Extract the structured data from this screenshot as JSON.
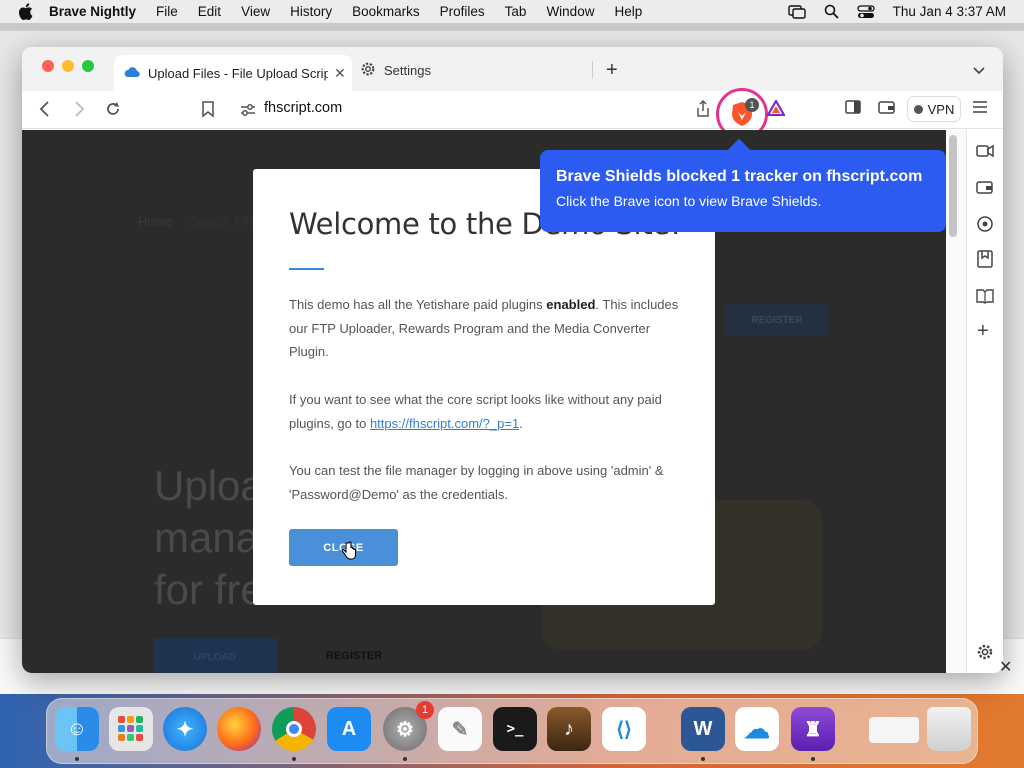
{
  "menubar": {
    "app_name": "Brave Nightly",
    "items": [
      "File",
      "Edit",
      "View",
      "History",
      "Bookmarks",
      "Profiles",
      "Tab",
      "Window",
      "Help"
    ],
    "clock": "Thu Jan 4  3:37 AM"
  },
  "browser": {
    "tabs": [
      {
        "title": "Upload Files - File Upload Script",
        "icon": "cloud-icon"
      },
      {
        "title": "Settings",
        "icon": "gear-icon"
      }
    ],
    "url": "fhscript.com",
    "vpn_label": "VPN",
    "shields_count": "1"
  },
  "page": {
    "breadcrumb_home": "Home",
    "breadcrumb_search": "Search Files",
    "register_top": "REGISTER",
    "hero_lines": [
      "Upload",
      "manage",
      "for free"
    ],
    "upload_button": "UPLOAD",
    "register_bottom": "REGISTER"
  },
  "modal": {
    "title": "Welcome to the Demo Site!",
    "para1_pre": "This demo has all the Yetishare paid plugins ",
    "para1_bold": "enabled",
    "para1_post": ". This includes our FTP Uploader, Rewards Program and the Media Converter Plugin.",
    "para2_pre": "If you want to see what the core script looks like without any paid plugins, go to ",
    "para2_link": "https://fhscript.com/?_p=1",
    "para2_post": ".",
    "para3": "You can test the file manager by logging in above using 'admin' & 'Password@Demo' as the credentials.",
    "close_label": "CLOSE"
  },
  "tooltip": {
    "title": "Brave Shields blocked 1 tracker on fhscript.com",
    "subtitle": "Click the Brave icon to view Brave Shields."
  },
  "dock": {
    "settings_badge": "1",
    "apps": [
      "Finder",
      "Launchpad",
      "Safari",
      "Firefox",
      "Chrome",
      "App Store",
      "System Settings",
      "TextEdit",
      "Terminal",
      "Instruments",
      "VS Code",
      "Word",
      "OneDrive",
      "Brave Nightly",
      "Downloads",
      "Trash"
    ]
  },
  "colors": {
    "tooltip_bg": "#2b5bf0",
    "close_btn": "#4a90d9",
    "link": "#2f7fd6"
  }
}
